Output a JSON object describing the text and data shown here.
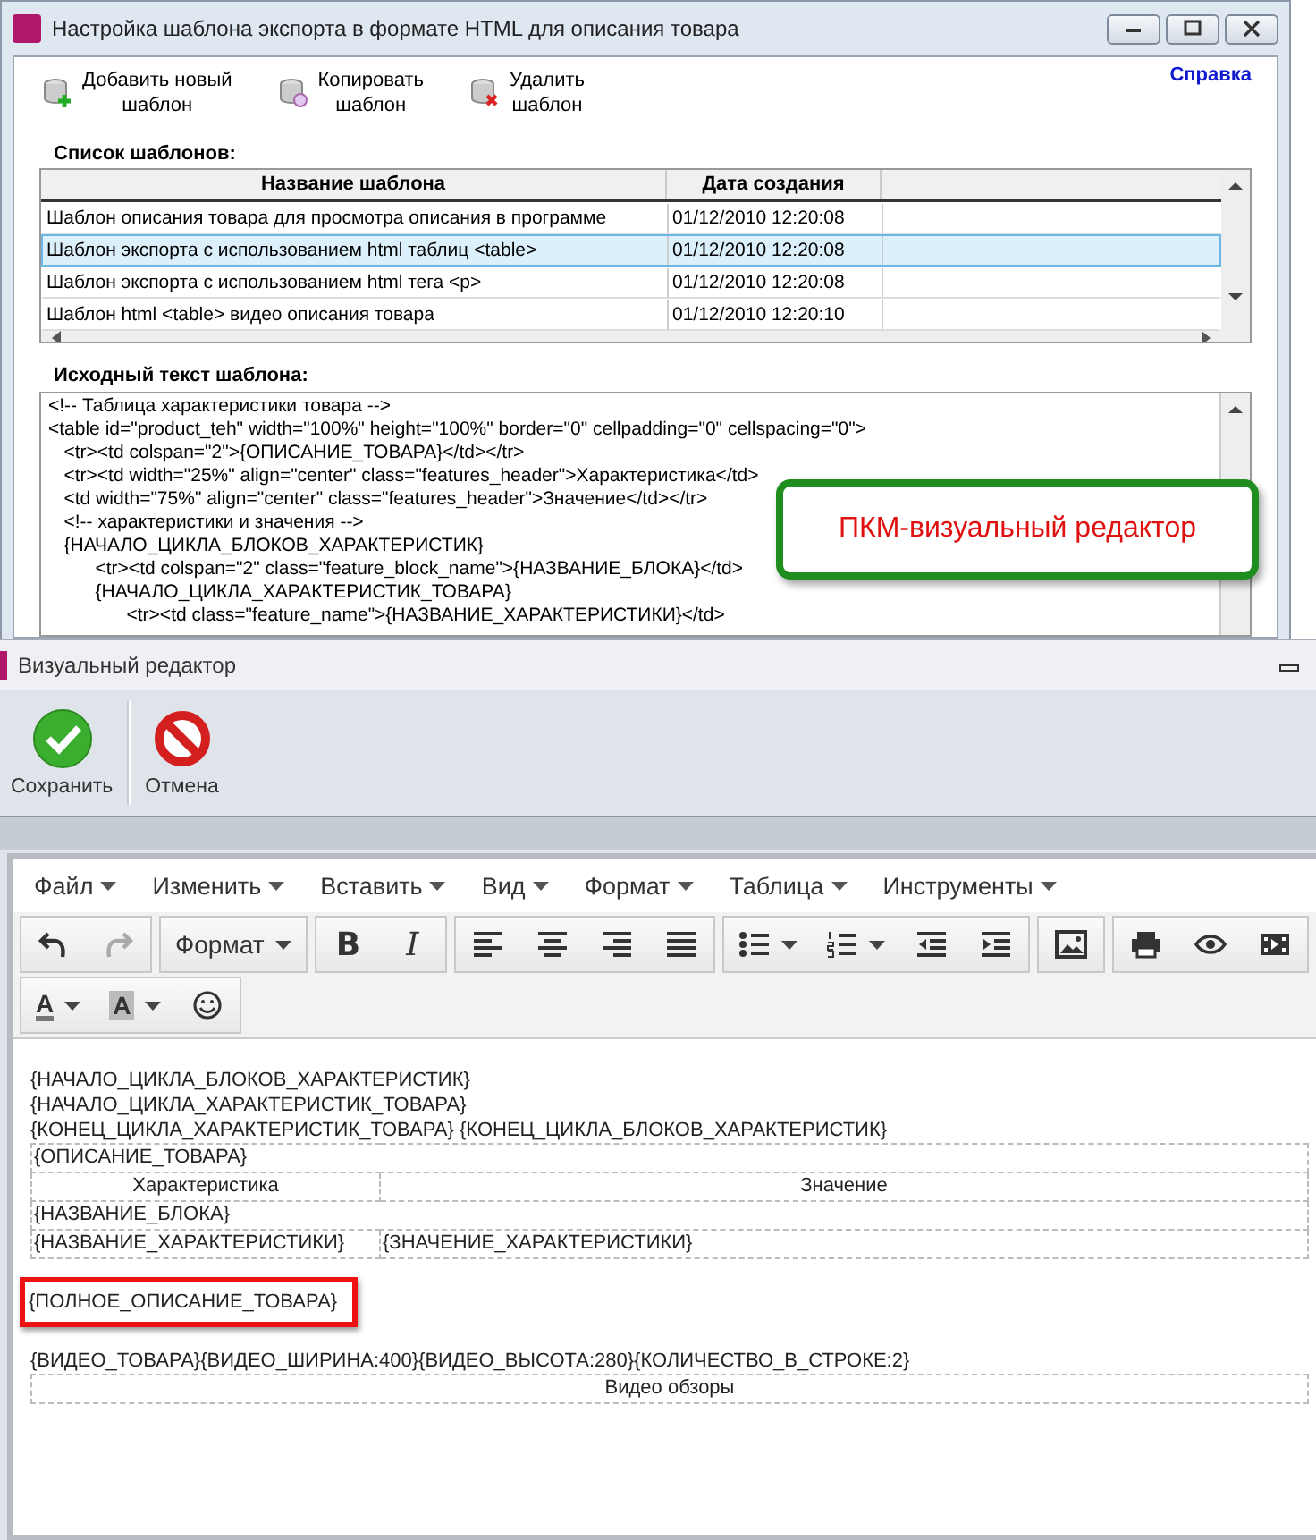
{
  "window": {
    "title": "Настройка шаблона экспорта в формате HTML для описания товара"
  },
  "help_link": "Справка",
  "toolbar": [
    {
      "kind": "add",
      "lines": [
        "Добавить новый",
        "шаблон"
      ]
    },
    {
      "kind": "copy",
      "lines": [
        "Копировать",
        "шаблон"
      ]
    },
    {
      "kind": "delete",
      "lines": [
        "Удалить",
        "шаблон"
      ]
    }
  ],
  "templates": {
    "title": "Список шаблонов:",
    "columns": [
      "Название шаблона",
      "Дата создания"
    ],
    "rows": [
      {
        "name": "Шаблон описания товара для просмотра описания в программе",
        "date": "01/12/2010 12:20:08",
        "selected": false
      },
      {
        "name": "Шаблон экспорта с использованием html таблиц <table>",
        "date": "01/12/2010 12:20:08",
        "selected": true
      },
      {
        "name": "Шаблон экспорта с использованием html тега <p>",
        "date": "01/12/2010 12:20:08",
        "selected": false
      },
      {
        "name": "Шаблон html <table> видео описания товара",
        "date": "01/12/2010 12:20:10",
        "selected": false
      }
    ]
  },
  "source": {
    "title": "Исходный текст шаблона:",
    "lines": [
      "<!-- Таблица характеристики товара -->",
      "<table id=\"product_teh\" width=\"100%\" height=\"100%\" border=\"0\" cellpadding=\"0\" cellspacing=\"0\">",
      "   <tr><td colspan=\"2\">{ОПИСАНИЕ_ТОВАРА}</td></tr>",
      "   <tr><td width=\"25%\" align=\"center\" class=\"features_header\">Характеристика</td>",
      "   <td width=\"75%\" align=\"center\" class=\"features_header\">Значение</td></tr>",
      "   <!-- характеристики и значения -->",
      "   {НАЧАЛО_ЦИКЛА_БЛОКОВ_ХАРАКТЕРИСТИК}",
      "         <tr><td colspan=\"2\" class=\"feature_block_name\">{НАЗВАНИЕ_БЛОКА}</td>",
      "         {НАЧАЛО_ЦИКЛА_ХАРАКТЕРИСТИК_ТОВАРА}",
      "               <tr><td class=\"feature_name\">{НАЗВАНИЕ_ХАРАКТЕРИСТИКИ}</td>"
    ]
  },
  "callout": "ПКМ-визуальный редактор",
  "editor": {
    "title": "Визуальный редактор",
    "actions": [
      {
        "kind": "save",
        "label": "Сохранить"
      },
      {
        "kind": "cancel",
        "label": "Отмена"
      }
    ],
    "menu": [
      "Файл",
      "Изменить",
      "Вставить",
      "Вид",
      "Формат",
      "Таблица",
      "Инструменты"
    ],
    "toolbar_rows": [
      [
        [
          {
            "kind": "undo",
            "disabled": false
          },
          {
            "kind": "redo",
            "disabled": true
          }
        ],
        [
          {
            "kind": "text",
            "label": "Формат",
            "dropdown": true
          }
        ],
        [
          {
            "kind": "bold",
            "label": "B"
          },
          {
            "kind": "italic",
            "label": "I"
          }
        ],
        [
          {
            "kind": "align-left"
          },
          {
            "kind": "align-center"
          },
          {
            "kind": "align-right"
          },
          {
            "kind": "justify"
          }
        ],
        [
          {
            "kind": "bullets",
            "dropdown": true
          },
          {
            "kind": "numbers",
            "dropdown": true
          },
          {
            "kind": "outdent"
          },
          {
            "kind": "indent"
          }
        ],
        [
          {
            "kind": "image"
          }
        ],
        [
          {
            "kind": "print"
          },
          {
            "kind": "preview"
          },
          {
            "kind": "media"
          }
        ]
      ],
      [
        [
          {
            "kind": "text-color",
            "label": "A",
            "dropdown": true
          },
          {
            "kind": "back-color",
            "label": "A",
            "dropdown": true
          },
          {
            "kind": "emoji"
          }
        ]
      ]
    ],
    "content": [
      {
        "kind": "line",
        "text": "{НАЧАЛО_ЦИКЛА_БЛОКОВ_ХАРАКТЕРИСТИК}"
      },
      {
        "kind": "line",
        "text": "{НАЧАЛО_ЦИКЛА_ХАРАКТЕРИСТИК_ТОВАРА}"
      },
      {
        "kind": "line",
        "text": "{КОНЕЦ_ЦИКЛА_ХАРАКТЕРИСТИК_ТОВАРА} {КОНЕЦ_ЦИКЛА_БЛОКОВ_ХАРАКТЕРИСТИК}"
      },
      {
        "kind": "table",
        "rows": [
          {
            "kind": "data",
            "cells": [
              {
                "text": "{ОПИСАНИЕ_ТОВАРА}",
                "colspan": 2
              }
            ]
          },
          {
            "kind": "header",
            "cells": [
              {
                "text": "Характеристика"
              },
              {
                "text": "Значение"
              }
            ]
          },
          {
            "kind": "data",
            "cells": [
              {
                "text": "{НАЗВАНИЕ_БЛОКА}",
                "colspan": 2
              }
            ]
          },
          {
            "kind": "data",
            "cells": [
              {
                "text": "{НАЗВАНИЕ_ХАРАКТЕРИСТИКИ}"
              },
              {
                "text": "{ЗНАЧЕНИЕ_ХАРАКТЕРИСТИКИ}"
              }
            ]
          }
        ]
      },
      {
        "kind": "highlighted",
        "text": "{ПОЛНОЕ_ОПИСАНИЕ_ТОВАРА}"
      },
      {
        "kind": "line",
        "text": "{ВИДЕО_ТОВАРА}{ВИДЕО_ШИРИНА:400}{ВИДЕО_ВЫСОТА:280}{КОЛИЧЕСТВО_В_СТРОКЕ:2}"
      },
      {
        "kind": "table",
        "rows": [
          {
            "kind": "header",
            "cells": [
              {
                "text": "Видео обзоры",
                "colspan": 2
              }
            ]
          }
        ]
      }
    ]
  }
}
